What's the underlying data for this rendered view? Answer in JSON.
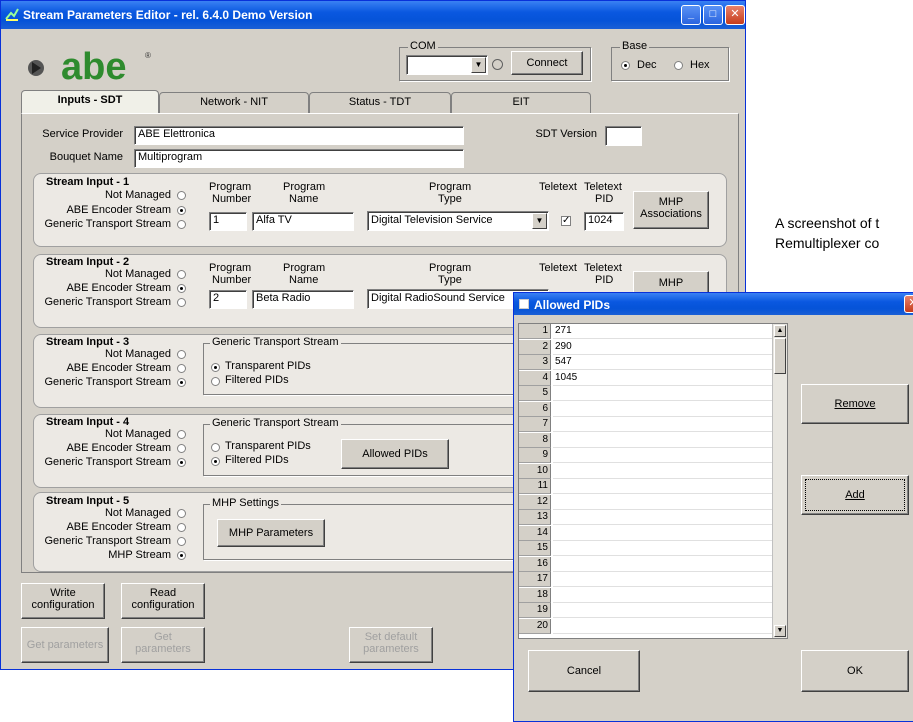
{
  "window": {
    "title": "Stream Parameters Editor - rel. 6.4.0  Demo Version"
  },
  "logo": {
    "text": "abe",
    "mark": "®",
    "color": "#2e8b2e"
  },
  "com": {
    "label": "COM",
    "value": "",
    "connect_label": "Connect"
  },
  "base": {
    "label": "Base",
    "options": [
      "Dec",
      "Hex"
    ],
    "selected": "Dec"
  },
  "tabs": [
    "Inputs - SDT",
    "Network - NIT",
    "Status - TDT",
    "EIT"
  ],
  "active_tab": "Inputs - SDT",
  "service_provider": {
    "label": "Service Provider",
    "value": "ABE Elettronica"
  },
  "bouquet_name": {
    "label": "Bouquet Name",
    "value": "Multiprogram"
  },
  "sdt_version": {
    "label": "SDT Version",
    "value": ""
  },
  "radio_labels": {
    "not_managed": "Not Managed",
    "abe_encoder": "ABE Encoder Stream",
    "generic_ts": "Generic Transport Stream",
    "mhp_stream": "MHP Stream"
  },
  "column_headers": {
    "program_number": [
      "Program",
      "Number"
    ],
    "program_name": [
      "Program",
      "Name"
    ],
    "program_type": [
      "Program",
      "Type"
    ],
    "teletext": "Teletext",
    "teletext_pid": [
      "Teletext",
      "PID"
    ]
  },
  "inputs": [
    {
      "title": "Stream Input - 1",
      "mode": "abe_encoder",
      "program_number": "1",
      "program_name": "Alfa TV",
      "program_type": "Digital Television Service",
      "teletext": true,
      "teletext_pid": "1024",
      "mhp_button": [
        "MHP",
        "Associations"
      ]
    },
    {
      "title": "Stream Input - 2",
      "mode": "abe_encoder",
      "program_number": "2",
      "program_name": "Beta Radio",
      "program_type": "Digital RadioSound Service",
      "mhp_button": [
        "MHP"
      ]
    },
    {
      "title": "Stream Input - 3",
      "mode": "generic_ts",
      "group_label": "Generic Transport Stream",
      "options": [
        "Transparent PIDs",
        "Filtered PIDs"
      ],
      "selected": "Transparent PIDs"
    },
    {
      "title": "Stream Input - 4",
      "mode": "generic_ts",
      "group_label": "Generic Transport Stream",
      "options": [
        "Transparent PIDs",
        "Filtered PIDs"
      ],
      "selected": "Filtered PIDs",
      "allowed_pids_label": "Allowed PIDs"
    },
    {
      "title": "Stream Input - 5",
      "mode": "mhp_stream",
      "group_label": "MHP Settings",
      "mhp_params_label": "MHP Parameters"
    }
  ],
  "bottom_buttons": {
    "write": [
      "Write",
      "configuration"
    ],
    "read": [
      "Read",
      "configuration"
    ],
    "get_parameters": "Get parameters",
    "get": [
      "Get",
      "parameters"
    ],
    "set_default": [
      "Set default",
      "parameters"
    ]
  },
  "caption": [
    "A screenshot of t",
    "Remultiplexer co"
  ],
  "dialog": {
    "title": "Allowed PIDs",
    "rows": [
      {
        "n": "1",
        "v": "271"
      },
      {
        "n": "2",
        "v": "290"
      },
      {
        "n": "3",
        "v": "547"
      },
      {
        "n": "4",
        "v": "1045"
      },
      {
        "n": "5",
        "v": ""
      },
      {
        "n": "6",
        "v": ""
      },
      {
        "n": "7",
        "v": ""
      },
      {
        "n": "8",
        "v": ""
      },
      {
        "n": "9",
        "v": ""
      },
      {
        "n": "10",
        "v": ""
      },
      {
        "n": "11",
        "v": ""
      },
      {
        "n": "12",
        "v": ""
      },
      {
        "n": "13",
        "v": ""
      },
      {
        "n": "14",
        "v": ""
      },
      {
        "n": "15",
        "v": ""
      },
      {
        "n": "16",
        "v": ""
      },
      {
        "n": "17",
        "v": ""
      },
      {
        "n": "18",
        "v": ""
      },
      {
        "n": "19",
        "v": ""
      },
      {
        "n": "20",
        "v": ""
      }
    ],
    "remove_label": "Remove",
    "add_label": "Add",
    "cancel_label": "Cancel",
    "ok_label": "OK"
  }
}
